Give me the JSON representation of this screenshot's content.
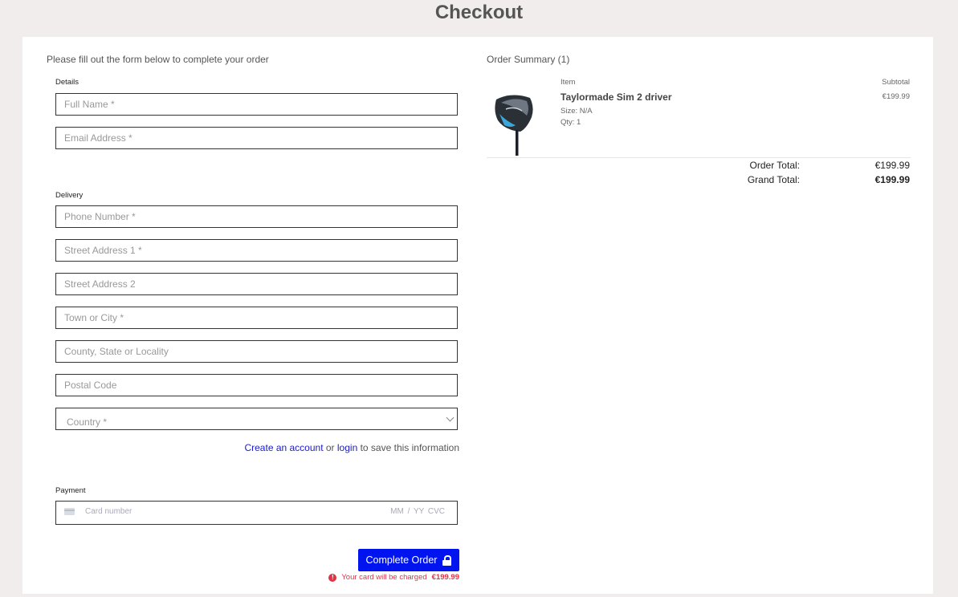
{
  "page": {
    "title": "Checkout"
  },
  "form": {
    "intro": "Please fill out the form below to complete your order",
    "details_label": "Details",
    "delivery_label": "Delivery",
    "payment_label": "Payment",
    "placeholders": {
      "full_name": "Full Name *",
      "email": "Email Address *",
      "phone": "Phone Number *",
      "street1": "Street Address 1 *",
      "street2": "Street Address 2",
      "town": "Town or City *",
      "county": "County, State or Locality",
      "postcode": "Postal Code"
    },
    "country_selected": "Country *",
    "account": {
      "create_link": "Create an account",
      "or": "or",
      "login_link": "login",
      "suffix": "to save this information"
    },
    "card": {
      "number_placeholder": "Card number",
      "expiry_cvc": "MM / YY  CVC"
    },
    "submit_label": "Complete Order",
    "charge_text": "Your card will be charged",
    "charge_amount": "€199.99"
  },
  "summary": {
    "title": "Order Summary (1)",
    "col_item": "Item",
    "col_subtotal": "Subtotal",
    "items": [
      {
        "name": "Taylormade Sim 2 driver",
        "size": "Size: N/A",
        "qty": "Qty: 1",
        "subtotal": "€199.99"
      }
    ],
    "order_total_label": "Order Total:",
    "order_total_value": "€199.99",
    "grand_total_label": "Grand Total:",
    "grand_total_value": "€199.99"
  },
  "icons": {
    "lock": "lock-icon",
    "alert": "alert-icon",
    "card": "card-icon",
    "chevron": "chevron-down-icon"
  },
  "colors": {
    "accent": "#0014ef",
    "error": "#dc3545",
    "link": "#1a1acb",
    "background": "#f2eded"
  }
}
